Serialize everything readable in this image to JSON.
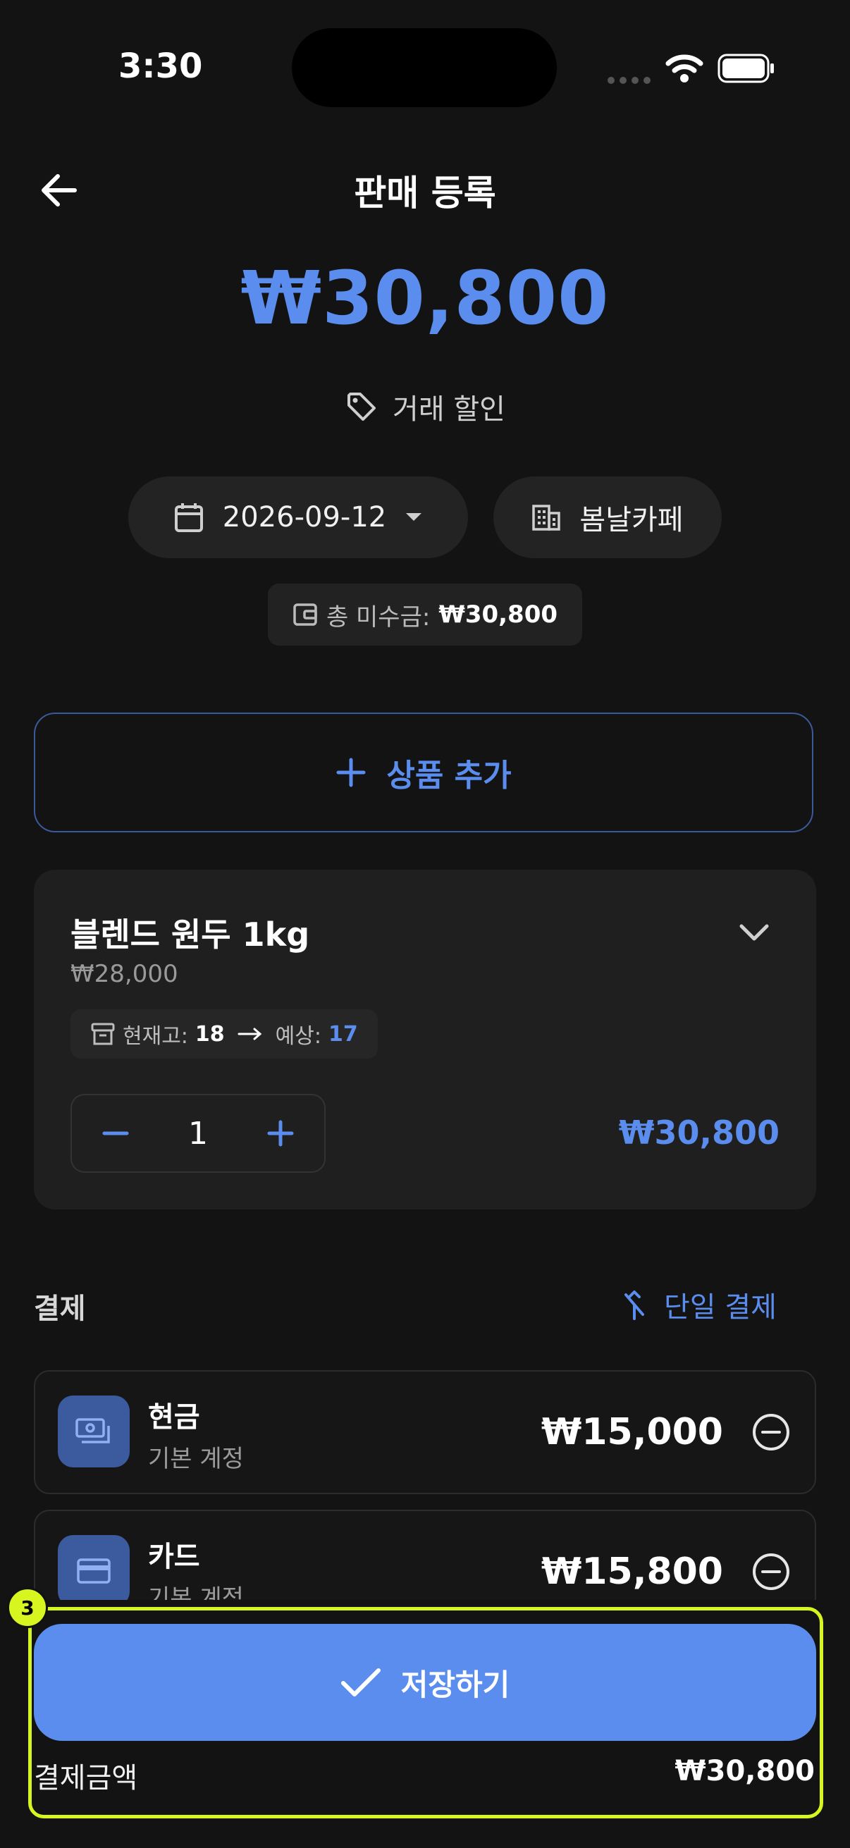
{
  "status_bar": {
    "time": "3:30"
  },
  "header": {
    "title": "판매 등록"
  },
  "summary": {
    "amount": "₩30,800",
    "discount_label": "거래 할인",
    "date": "2026-09-12",
    "partner": "봄날카페",
    "debt_label": "총 미수금:",
    "debt_value": "₩30,800"
  },
  "add_product": {
    "label": "상품 추가"
  },
  "product": {
    "name": "블렌드 원두 1kg",
    "price": "₩28,000",
    "stock_label": "현재고:",
    "stock_value": "18",
    "expected_label": "예상:",
    "expected_value": "17",
    "quantity": "1",
    "line_total": "₩30,800"
  },
  "payment": {
    "title": "결제",
    "split_label": "단일 결제",
    "methods": [
      {
        "name": "현금",
        "account": "기본 계정",
        "amount": "₩15,000"
      },
      {
        "name": "카드",
        "account": "기본 계정",
        "amount": "₩15,800"
      }
    ]
  },
  "footer": {
    "save_label": "저장하기",
    "total_label": "결제금액",
    "total_value": "₩30,800"
  },
  "annotation": {
    "badge": "3"
  },
  "colors": {
    "accent": "#5b8dee",
    "background": "#131313",
    "card": "#1f1f1f",
    "highlight": "#d7f51f"
  }
}
